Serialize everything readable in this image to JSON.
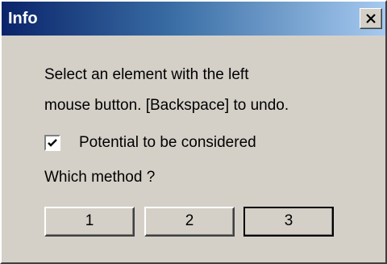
{
  "window": {
    "title": "Info",
    "close_glyph": "✕",
    "title_gradient": [
      "#0a246a",
      "#a6caf0"
    ],
    "background": "#d4d0c8"
  },
  "message": {
    "line1": "Select an element with the left",
    "line2": "mouse button. [Backspace] to undo."
  },
  "checkbox": {
    "label": "Potential to be considered",
    "checked": true,
    "icon": "checkmark-icon"
  },
  "question": "Which method ?",
  "buttons": [
    {
      "label": "1",
      "default": false
    },
    {
      "label": "2",
      "default": false
    },
    {
      "label": "3",
      "default": true
    }
  ]
}
